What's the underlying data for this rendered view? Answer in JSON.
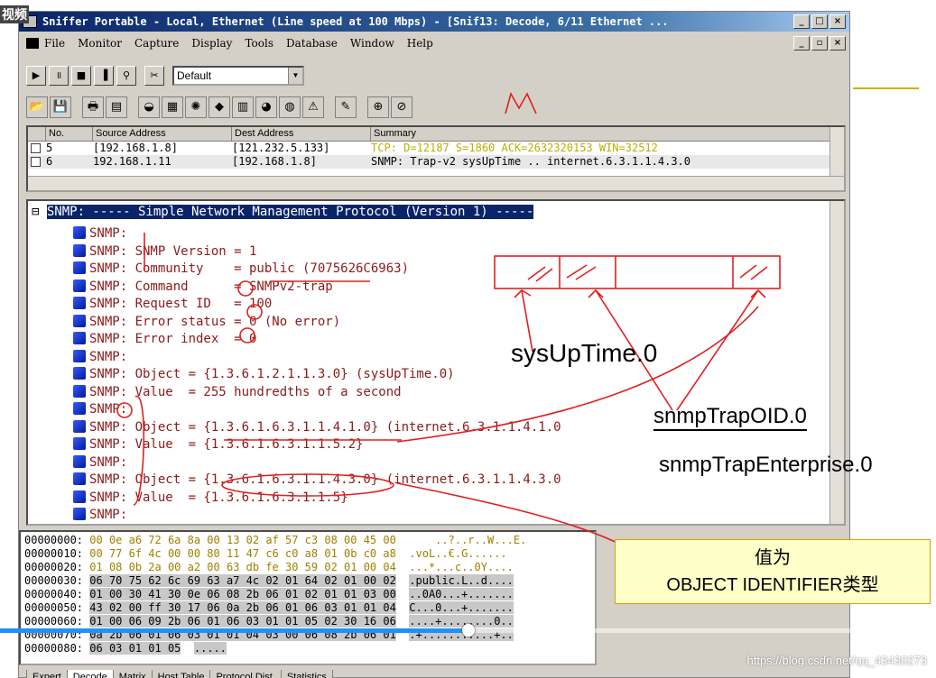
{
  "window": {
    "title": "Sniffer Portable - Local, Ethernet (Line speed at 100 Mbps) - [Snif13: Decode, 6/11 Ethernet ...",
    "corner_label": "视频"
  },
  "menu": [
    "File",
    "Monitor",
    "Capture",
    "Display",
    "Tools",
    "Database",
    "Window",
    "Help"
  ],
  "toolbar": {
    "filter_value": "Default"
  },
  "packet_list": {
    "columns": [
      "No.",
      "Source Address",
      "Dest Address",
      "Summary"
    ],
    "rows": [
      {
        "no": "5",
        "src": "[192.168.1.8]",
        "dst": "[121.232.5.133]",
        "summary": "TCP: D=12187 S=1860      ACK=2632320153 WIN=32512"
      },
      {
        "no": "6",
        "src": "192.168.1.11",
        "dst": "[192.168.1.8]",
        "summary": "SNMP: Trap-v2  sysUpTime .. internet.6.3.1.1.4.3.0"
      }
    ]
  },
  "decode": {
    "header": "SNMP: ----- Simple Network Management Protocol (Version 1) -----",
    "lines": [
      "SNMP:",
      "SNMP: SNMP Version = 1",
      "SNMP: Community    = public (7075626C6963)",
      "SNMP: Command      = SNMPv2-trap",
      "SNMP: Request ID   = 100",
      "SNMP: Error status = 0 (No error)",
      "SNMP: Error index  = 0",
      "SNMP:",
      "SNMP: Object = {1.3.6.1.2.1.1.3.0} (sysUpTime.0)",
      "SNMP: Value  = 255 hundredths of a second",
      "SNMP:",
      "SNMP: Object = {1.3.6.1.6.3.1.1.4.1.0} (internet.6.3.1.1.4.1.0",
      "SNMP: Value  = {1.3.6.1.6.3.1.1.5.2}",
      "SNMP:",
      "SNMP: Object = {1.3.6.1.6.3.1.1.4.3.0} (internet.6.3.1.1.4.3.0",
      "SNMP: Value  = {1.3.6.1.6.3.1.1.5}",
      "SNMP:"
    ]
  },
  "hex": [
    {
      "addr": "00000000:",
      "bytes": "00 0e a6 72 6a 8a 00 13 02 af 57 c3 08 00 45 00",
      "ascii": "    ..?..r..W...E."
    },
    {
      "addr": "00000010:",
      "bytes": "00 77 6f 4c 00 00 80 11 47 c6 c0 a8 01 0b c0 a8",
      "ascii": ".voL..€.G......"
    },
    {
      "addr": "00000020:",
      "bytes": "01 08 0b 2a 00 a2 00 63 db fe 30 59 02 01 00 04",
      "ascii": "...*...c..0Y...."
    },
    {
      "addr": "00000030:",
      "bytes": "06 70 75 62 6c 69 63 a7 4c 02 01 64 02 01 00 02",
      "ascii": ".public.L..d...."
    },
    {
      "addr": "00000040:",
      "bytes": "01 00 30 41 30 0e 06 08 2b 06 01 02 01 01 03 00",
      "ascii": "..0A0...+......."
    },
    {
      "addr": "00000050:",
      "bytes": "43 02 00 ff 30 17 06 0a 2b 06 01 06 03 01 01 04",
      "ascii": "C...0...+......."
    },
    {
      "addr": "00000060:",
      "bytes": "01 00 06 09 2b 06 01 06 03 01 01 05 02 30 16 06",
      "ascii": "....+........0.."
    },
    {
      "addr": "00000070:",
      "bytes": "0a 2b 06 01 06 03 01 01 04 03 00 06 08 2b 06 01",
      "ascii": ".+...........+.."
    },
    {
      "addr": "00000080:",
      "bytes": "06 03 01 01 05",
      "ascii": "....."
    }
  ],
  "tabs": [
    "Expert",
    "Decode",
    "Matrix",
    "Host Table",
    "Protocol Dist.",
    "Statistics"
  ],
  "annotations": {
    "handwritten_m": "M",
    "sysuptime": "sysUpTime.0",
    "snmptrapoid": "snmpTrapOID.0",
    "snmptrapenterprise": "snmpTrapEnterprise.0",
    "callout_line1": "值为",
    "callout_line2": "OBJECT IDENTIFIER类型",
    "watermark": "https://blog.csdn.net/qq_43430273"
  },
  "video": {
    "progress_fraction": 0.5
  },
  "colors": {
    "annotation_red": "#e02020",
    "title_blue": "#0a246a",
    "decode_text": "#8b1a1a"
  }
}
